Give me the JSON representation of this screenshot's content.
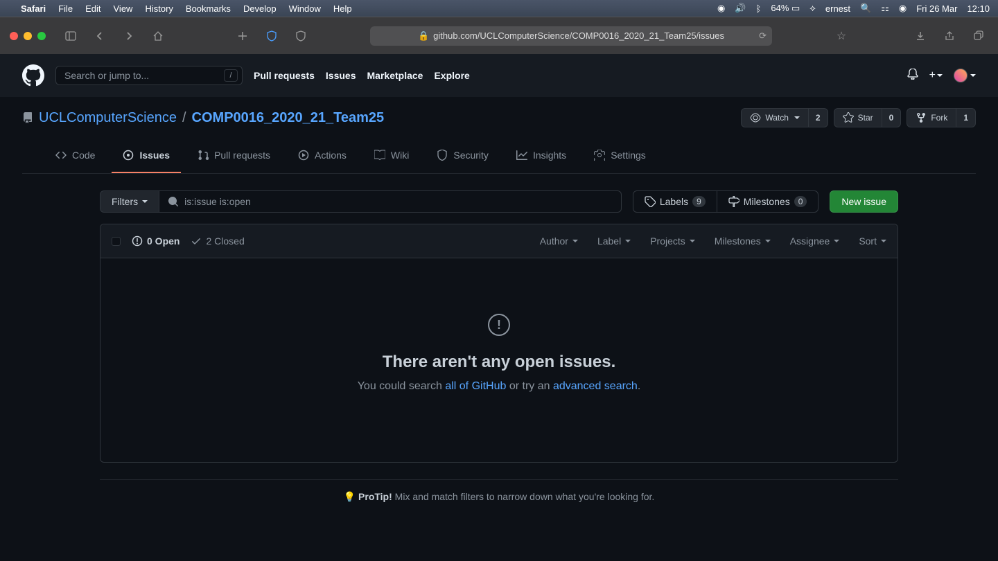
{
  "mac": {
    "app": "Safari",
    "menus": [
      "File",
      "Edit",
      "View",
      "History",
      "Bookmarks",
      "Develop",
      "Window",
      "Help"
    ],
    "battery": "64%",
    "user": "ernest",
    "date": "Fri 26 Mar",
    "time": "12:10"
  },
  "safari": {
    "url_display": "github.com/UCLComputerScience/COMP0016_2020_21_Team25/issues"
  },
  "gh": {
    "search_placeholder": "Search or jump to...",
    "search_key": "/",
    "nav": {
      "pulls": "Pull requests",
      "issues": "Issues",
      "marketplace": "Marketplace",
      "explore": "Explore"
    }
  },
  "repo": {
    "owner": "UCLComputerScience",
    "name": "COMP0016_2020_21_Team25",
    "watch": {
      "label": "Watch",
      "count": "2"
    },
    "star": {
      "label": "Star",
      "count": "0"
    },
    "fork": {
      "label": "Fork",
      "count": "1"
    },
    "tabs": {
      "code": "Code",
      "issues": "Issues",
      "pulls": "Pull requests",
      "actions": "Actions",
      "wiki": "Wiki",
      "security": "Security",
      "insights": "Insights",
      "settings": "Settings"
    }
  },
  "issues": {
    "filters_label": "Filters",
    "search_value": "is:issue is:open",
    "labels": {
      "label": "Labels",
      "count": "9"
    },
    "milestones": {
      "label": "Milestones",
      "count": "0"
    },
    "new_issue": "New issue",
    "open_count": "0 Open",
    "closed_count": "2 Closed",
    "dd": {
      "author": "Author",
      "label": "Label",
      "projects": "Projects",
      "milestones": "Milestones",
      "assignee": "Assignee",
      "sort": "Sort"
    },
    "empty": {
      "title": "There aren't any open issues.",
      "prefix": "You could search ",
      "link1": "all of GitHub",
      "mid": " or try an ",
      "link2": "advanced search",
      "suffix": "."
    },
    "protip": {
      "label": "ProTip!",
      "text": " Mix and match filters to narrow down what you're looking for."
    }
  }
}
